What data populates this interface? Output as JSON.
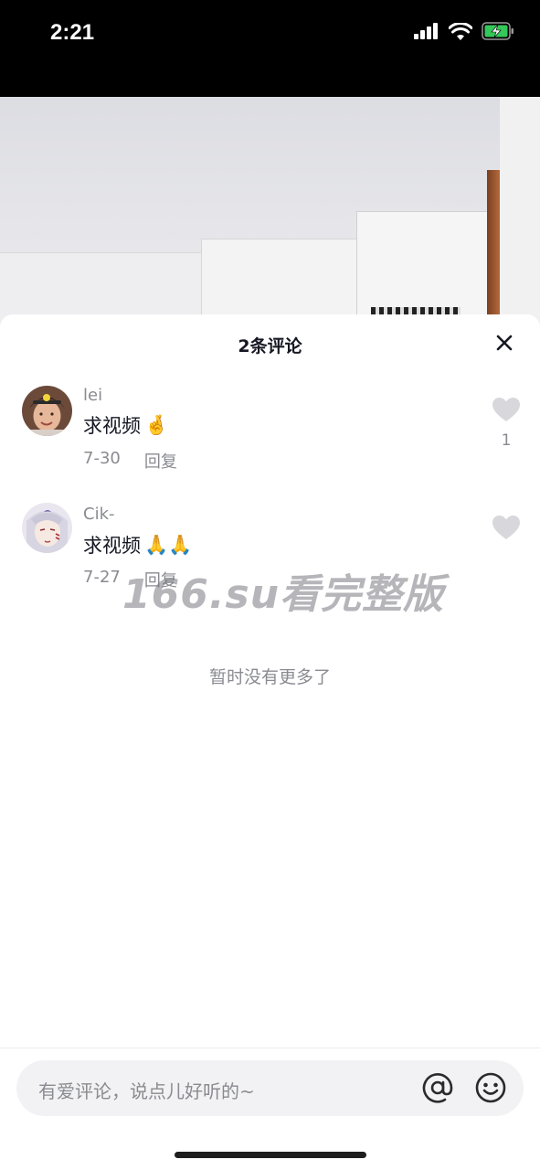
{
  "status_bar": {
    "time": "2:21"
  },
  "comments_sheet": {
    "title": "2条评论",
    "comments": [
      {
        "username": "lei",
        "text": "求视频",
        "emoji": "🤞",
        "date": "7-30",
        "reply_label": "回复",
        "like_count": "1"
      },
      {
        "username": "Cik-",
        "text": "求视频",
        "emoji": "🙏🙏",
        "date": "7-27",
        "reply_label": "回复",
        "like_count": ""
      }
    ],
    "watermark": "166.su看完整版",
    "no_more_text": "暂时没有更多了"
  },
  "input_bar": {
    "placeholder": "有爱评论，说点儿好听的~"
  },
  "icons": [
    "signal-icon",
    "wifi-icon",
    "battery-charging-icon",
    "close-icon",
    "heart-icon",
    "at-icon",
    "emoji-icon"
  ],
  "colors": {
    "text_primary": "#161823",
    "text_secondary": "#8a8b91",
    "battery": "#34c759"
  }
}
